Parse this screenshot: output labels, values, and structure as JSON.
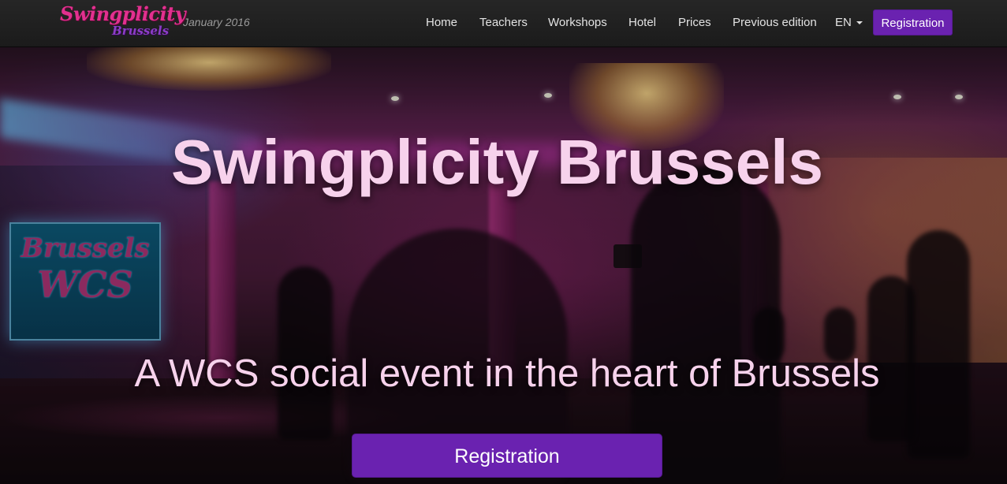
{
  "brand": {
    "logo_line1": "Swingplicity",
    "logo_line2": "Brussels",
    "date": "January 2016"
  },
  "nav": {
    "items": [
      {
        "label": "Home"
      },
      {
        "label": "Teachers"
      },
      {
        "label": "Workshops"
      },
      {
        "label": "Hotel"
      },
      {
        "label": "Prices"
      },
      {
        "label": "Previous edition"
      }
    ],
    "language": "EN",
    "register_label": "Registration"
  },
  "hero": {
    "title": "Swingplicity Brussels",
    "subtitle": "A WCS social event in the heart of Brussels",
    "cta_label": "Registration",
    "banner_text_line1": "Brussels",
    "banner_text_line2": "WCS"
  },
  "colors": {
    "navbar_bg": "#222222",
    "accent_purple": "#6a22b0",
    "logo_pink": "#e2308f",
    "logo_purple": "#8c3dc7",
    "hero_text": "#f7d2ec"
  }
}
